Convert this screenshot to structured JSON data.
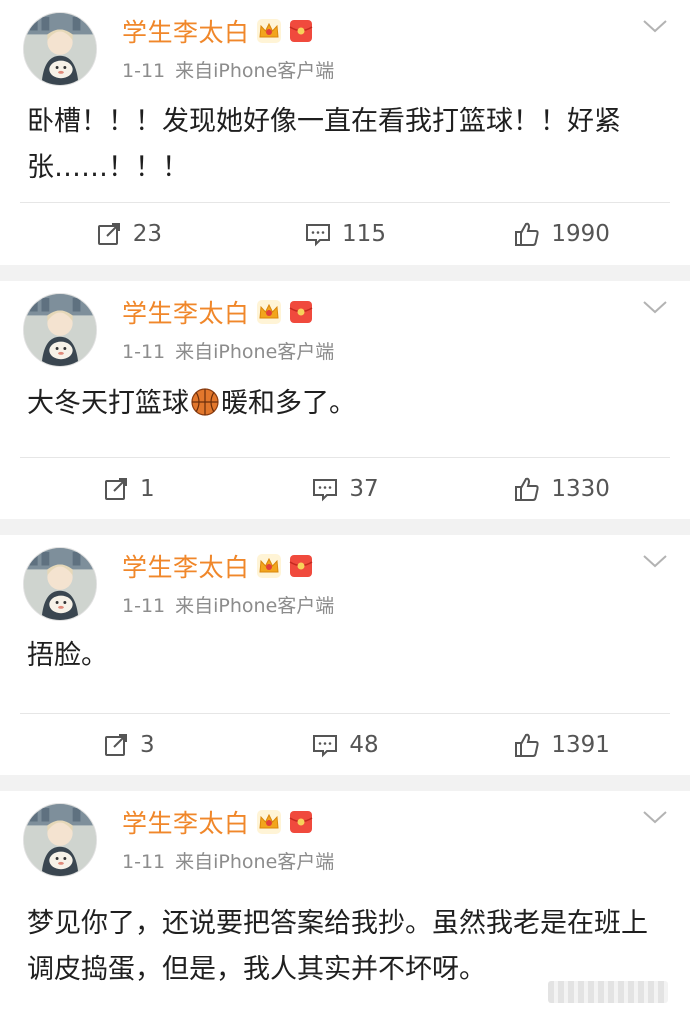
{
  "posts": [
    {
      "name": "学生李太白",
      "date": "1-11",
      "source": "来自iPhone客户端",
      "text": "卧槽！！！发现她好像一直在看我打篮球！！好紧张……！！！",
      "repost": "23",
      "comment": "115",
      "like": "1990"
    },
    {
      "name": "学生李太白",
      "date": "1-11",
      "source": "来自iPhone客户端",
      "text_before": "大冬天打篮球",
      "text_after": "暖和多了。",
      "repost": "1",
      "comment": "37",
      "like": "1330"
    },
    {
      "name": "学生李太白",
      "date": "1-11",
      "source": "来自iPhone客户端",
      "text": "捂脸。",
      "repost": "3",
      "comment": "48",
      "like": "1391"
    },
    {
      "name": "学生李太白",
      "date": "1-11",
      "source": "来自iPhone客户端",
      "text": "梦见你了，还说要把答案给我抄。虽然我老是在班上调皮捣蛋，但是，我人其实并不坏呀。"
    }
  ],
  "icons": {
    "crown": "crown-badge-icon",
    "red": "red-packet-icon",
    "more": "chevron-down-icon",
    "repost": "repost-icon",
    "comment": "comment-icon",
    "like": "thumbs-up-icon",
    "basketball": "basketball-emoji-icon"
  },
  "colors": {
    "name": "#f0872a",
    "meta": "#8c8c8c",
    "text": "#1f1f1f",
    "separator": "#f2f2f2"
  }
}
